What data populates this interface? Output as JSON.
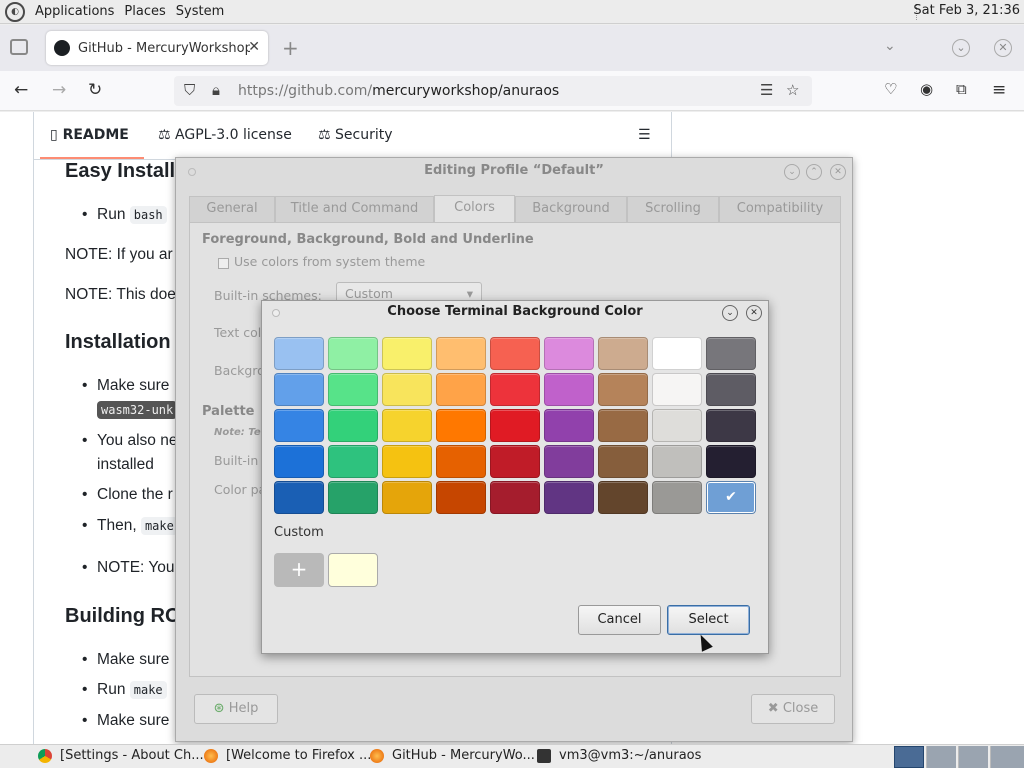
{
  "top_panel": {
    "menus": [
      "Applications",
      "Places",
      "System"
    ],
    "clock": "Sat Feb  3, 21:36"
  },
  "browser": {
    "tab_title": "GitHub - MercuryWorkshop/anuraos",
    "url_prefix": "https://github.com/",
    "url_path": "mercuryworkshop/anuraos"
  },
  "page": {
    "readme_tabs": [
      "README",
      "AGPL-3.0 license",
      "Security"
    ],
    "h_easy": "Easy Install",
    "run": "Run",
    "code_bash": "bash",
    "note1": "NOTE: If you ar",
    "note2": "NOTE: This doe",
    "h_install": "Installation",
    "make_sure": "Make sure",
    "code_wasm": "wasm32-unk",
    "you_also": "You also ne",
    "installed": "installed",
    "clone": "Clone the r",
    "then": "Then,",
    "code_make": "make",
    "note_you": "NOTE: You",
    "h_building": "Building RO",
    "make_sure2": "Make sure",
    "run2": "Run",
    "code_make2": "make",
    "make_sure3": "Make sure"
  },
  "profile_dialog": {
    "title": "Editing Profile “Default”",
    "tabs": [
      "General",
      "Title and Command",
      "Colors",
      "Background",
      "Scrolling",
      "Compatibility"
    ],
    "section_fg": "Foreground, Background, Bold and Underline",
    "use_system_colors": "Use colors from system theme",
    "builtin_schemes": "Built-in schemes:",
    "scheme_value": "Custom",
    "text_color": "Text colo",
    "background": "Backgro",
    "palette": "Palette",
    "note": "Note: Ter",
    "builtin_s": "Built-in s",
    "color_pa": "Color pa",
    "help": "Help",
    "close": "Close"
  },
  "color_chooser": {
    "title": "Choose Terminal Background Color",
    "custom_label": "Custom",
    "add_symbol": "+",
    "check": "✔",
    "custom_color": "#ffffdc",
    "cancel": "Cancel",
    "select": "Select",
    "columns": [
      [
        "#99c1f1",
        "#62a0ea",
        "#3584e4",
        "#1c71d8",
        "#1a5fb4"
      ],
      [
        "#8ff0a4",
        "#57e389",
        "#33d17a",
        "#2ec27e",
        "#26a269"
      ],
      [
        "#f9f06b",
        "#f8e45c",
        "#f6d32d",
        "#f5c211",
        "#e5a50a"
      ],
      [
        "#ffbe6f",
        "#ffa348",
        "#ff7800",
        "#e66100",
        "#c64600"
      ],
      [
        "#f66151",
        "#ed333b",
        "#e01b24",
        "#c01c28",
        "#a51d2d"
      ],
      [
        "#dc8add",
        "#c061cb",
        "#9141ac",
        "#813d9c",
        "#613583"
      ],
      [
        "#cdab8f",
        "#b5835a",
        "#986a44",
        "#865e3c",
        "#63452c"
      ],
      [
        "#ffffff",
        "#f6f5f4",
        "#deddda",
        "#c0bfbc",
        "#9a9996"
      ],
      [
        "#77767b",
        "#5e5c64",
        "#3d3846",
        "#241f31",
        "#6f9fd5"
      ]
    ],
    "selected": {
      "column": 8,
      "row": 4
    }
  },
  "taskbar": {
    "items": [
      "[Settings - About Ch...",
      "[Welcome to Firefox ...",
      "GitHub - MercuryWo...",
      "vm3@vm3:~/anuraos"
    ]
  }
}
